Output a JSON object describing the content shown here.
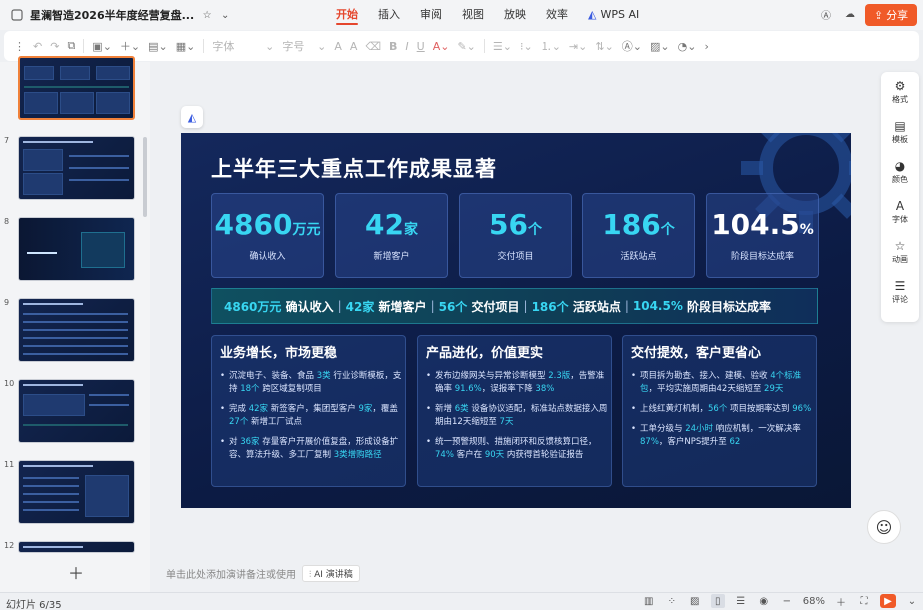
{
  "window": {
    "doc_title": "星澜智造2026半年度经营复盘...",
    "menu": [
      "开始",
      "插入",
      "审阅",
      "视图",
      "放映",
      "效率"
    ],
    "active_menu": "开始",
    "wps_ai": "WPS AI",
    "share": "分享"
  },
  "toolbar": {
    "font_name": "字体",
    "font_size": "字号"
  },
  "thumbnails": [
    {
      "num": ""
    },
    {
      "num": "7"
    },
    {
      "num": "8"
    },
    {
      "num": "9"
    },
    {
      "num": "10"
    },
    {
      "num": "11"
    },
    {
      "num": "12"
    }
  ],
  "slide": {
    "title": "上半年三大重点工作成果显著",
    "kpis": [
      {
        "value": "4860",
        "unit": "万元",
        "label": "确认收入"
      },
      {
        "value": "42",
        "unit": "家",
        "label": "新增客户"
      },
      {
        "value": "56",
        "unit": "个",
        "label": "交付项目"
      },
      {
        "value": "186",
        "unit": "个",
        "label": "活跃站点"
      },
      {
        "value": "104.5",
        "unit": "%",
        "label": "阶段目标达成率"
      }
    ],
    "banner": {
      "v1": "4860万元",
      "t1": "确认收入",
      "v2": "42家",
      "t2": "新增客户",
      "v3": "56个",
      "t3": "交付项目",
      "v4": "186个",
      "t4": "活跃站点",
      "v5": "104.5%",
      "t5": "阶段目标达成率"
    },
    "cards": [
      {
        "title": "业务增长，市场更稳",
        "items": [
          {
            "a": "沉淀电子、装备、食品 ",
            "h1": "3类",
            "b": " 行业诊断模板，支持 ",
            "h2": "18个",
            "c": " 跨区域复制项目"
          },
          {
            "a": "完成 ",
            "h1": "42家",
            "b": " 新签客户，集团型客户 ",
            "h2": "9家",
            "c": "，覆盖 ",
            "h3": "27个",
            "d": " 新增工厂试点"
          },
          {
            "a": "对 ",
            "h1": "36家",
            "b": " 存量客户开展价值复盘，形成设备扩容、算法升级、多工厂复制 ",
            "h2": "3类增购路径",
            "c": ""
          }
        ]
      },
      {
        "title": "产品进化，价值更实",
        "items": [
          {
            "a": "发布边缘网关与异常诊断模型 ",
            "h1": "2.3版",
            "b": "，告警准确率 ",
            "h2": "91.6%",
            "c": "，误报率下降 ",
            "h3": "38%",
            "d": ""
          },
          {
            "a": "新增 ",
            "h1": "6类",
            "b": " 设备协议适配，标准站点数据接入周期由12天缩短至 ",
            "h2": "7天",
            "c": ""
          },
          {
            "a": "统一预警规则、措施闭环和反馈核算口径，",
            "h1": "74%",
            "b": " 客户在 ",
            "h2": "90天",
            "c": " 内获得首轮验证报告"
          }
        ]
      },
      {
        "title": "交付提效，客户更省心",
        "items": [
          {
            "a": "项目拆为勘查、接入、建模、验收 ",
            "h1": "4个标准包",
            "b": "，平均实施周期由42天缩短至 ",
            "h2": "29天",
            "c": ""
          },
          {
            "a": "上线红黄灯机制，",
            "h1": "56个",
            "b": " 项目按期率达到 ",
            "h2": "96%",
            "c": ""
          },
          {
            "a": "工单分级与 ",
            "h1": "24小时",
            "b": " 响应机制，一次解决率 ",
            "h2": "87%",
            "c": "，客户NPS提升至 ",
            "h3": "62",
            "d": ""
          }
        ]
      }
    ]
  },
  "right_panel": [
    "格式",
    "模板",
    "颜色",
    "字体",
    "动画",
    "评论"
  ],
  "notes": {
    "placeholder": "单击此处添加演讲备注或使用",
    "ai_button": "AI 演讲稿"
  },
  "status": {
    "slide_count": "幻灯片 6/35",
    "zoom": "68%"
  },
  "colors": {
    "accent": "#38d6f2",
    "share": "#f05a28",
    "slide_bg": "#0e2050"
  }
}
